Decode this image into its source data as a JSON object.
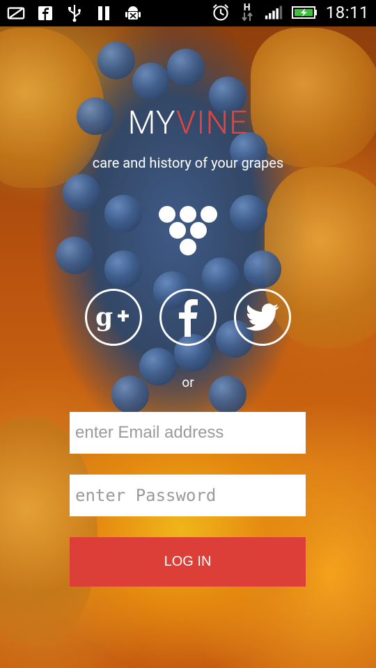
{
  "status_bar": {
    "time": "18:11",
    "network_type": "H",
    "icons": [
      "signal-off-icon",
      "facebook-icon",
      "usb-icon",
      "pause-icon",
      "android-debug-icon",
      "alarm-icon",
      "network-h-icon",
      "signal-bars-icon",
      "battery-charging-icon"
    ]
  },
  "brand": {
    "part1": "MY",
    "part2": "VINE"
  },
  "tagline": "care and history of your grapes",
  "social": {
    "buttons": [
      "google-plus",
      "facebook",
      "twitter"
    ]
  },
  "or_text": "or",
  "login_form": {
    "email_placeholder": "enter Email address",
    "password_placeholder": "enter Password",
    "login_label": "LOG IN"
  },
  "colors": {
    "accent": "#dc3f38",
    "brand_red": "#e2453d",
    "white": "#ffffff"
  }
}
